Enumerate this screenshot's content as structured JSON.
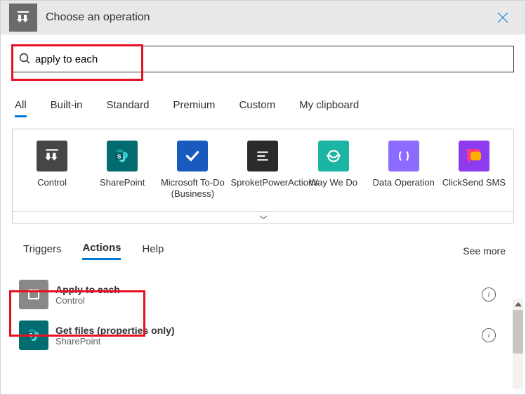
{
  "header": {
    "title": "Choose an operation"
  },
  "search": {
    "value": "apply to each"
  },
  "filter_tabs": [
    {
      "label": "All",
      "active": true
    },
    {
      "label": "Built-in",
      "active": false
    },
    {
      "label": "Standard",
      "active": false
    },
    {
      "label": "Premium",
      "active": false
    },
    {
      "label": "Custom",
      "active": false
    },
    {
      "label": "My clipboard",
      "active": false
    }
  ],
  "connectors": [
    {
      "label": "Control",
      "bg": "#484644",
      "icon": "control"
    },
    {
      "label": "SharePoint",
      "bg": "#036c70",
      "icon": "sharepoint"
    },
    {
      "label": "Microsoft To-Do (Business)",
      "bg": "#185abd",
      "icon": "todo"
    },
    {
      "label": "SproketPowerActions",
      "bg": "#2b2b2b",
      "icon": "sproket"
    },
    {
      "label": "Way We Do",
      "bg": "#1bb4a5",
      "icon": "wayweido"
    },
    {
      "label": "Data Operation",
      "bg": "#8c6cff",
      "icon": "dataop"
    },
    {
      "label": "ClickSend SMS",
      "bg": "#8c3cee",
      "icon": "clicksend"
    }
  ],
  "sub_tabs": {
    "items": [
      {
        "label": "Triggers",
        "active": false
      },
      {
        "label": "Actions",
        "active": true
      },
      {
        "label": "Help",
        "active": false
      }
    ],
    "see_more": "See more"
  },
  "actions": [
    {
      "title": "Apply to each",
      "subtitle": "Control",
      "bg": "#8a8886",
      "icon": "loop"
    },
    {
      "title": "Get files (properties only)",
      "subtitle": "SharePoint",
      "bg": "#036c70",
      "icon": "sharepoint"
    }
  ]
}
